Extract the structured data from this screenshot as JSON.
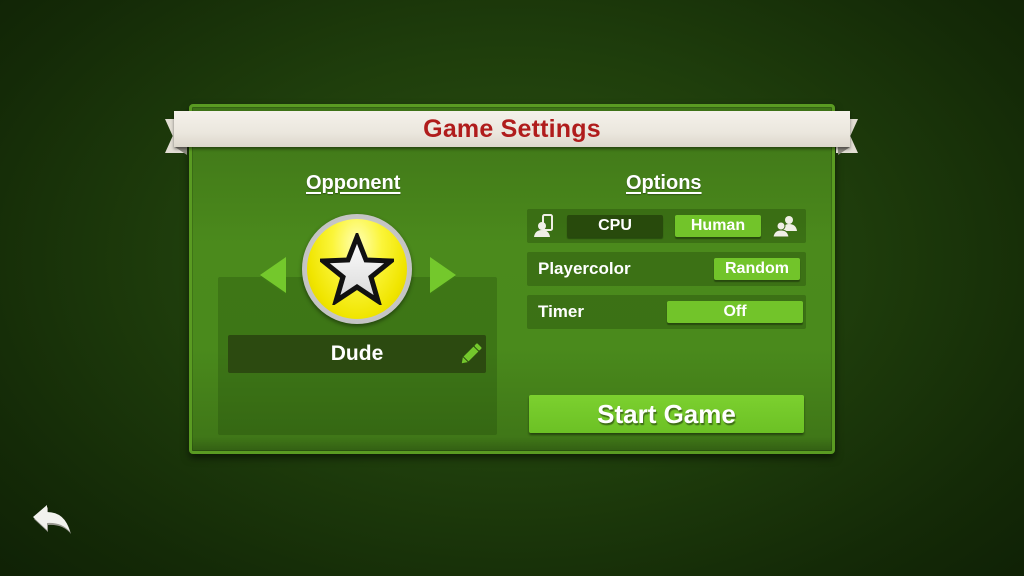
{
  "dialog": {
    "title": "Game Settings"
  },
  "opponent": {
    "heading": "Opponent",
    "name": "Dude",
    "avatar_icon": "star-icon",
    "prev_icon": "arrow-left-icon",
    "next_icon": "arrow-right-icon",
    "edit_icon": "pencil-icon"
  },
  "options": {
    "heading": "Options",
    "mode": {
      "left_icon": "player-vs-device-icon",
      "right_icon": "two-players-icon",
      "choices": [
        {
          "label": "CPU",
          "selected": false
        },
        {
          "label": "Human",
          "selected": true
        }
      ]
    },
    "playercolor": {
      "label": "Playercolor",
      "value": "Random"
    },
    "timer": {
      "label": "Timer",
      "value": "Off"
    }
  },
  "actions": {
    "start_label": "Start Game",
    "back_icon": "back-arrow-icon"
  },
  "colors": {
    "title_red": "#b01c1c",
    "active_green": "#72c42a",
    "inactive_dark": "#284a0c"
  }
}
